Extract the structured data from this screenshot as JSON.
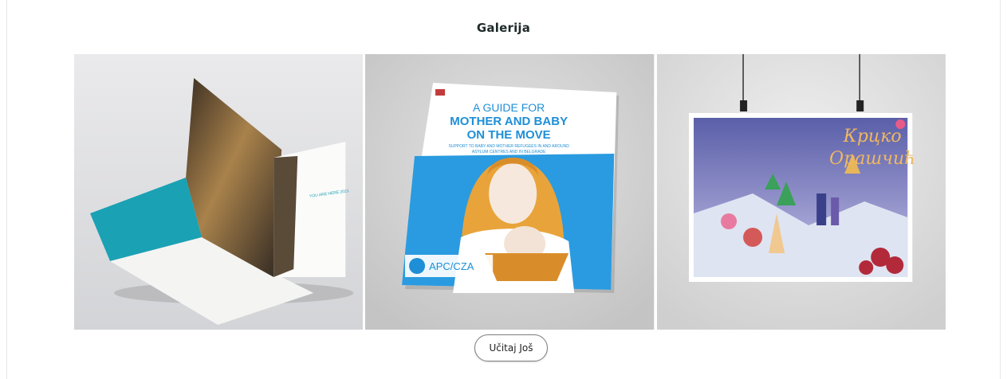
{
  "section": {
    "title": "Galerija",
    "load_more_label": "Učitaj Još"
  },
  "gallery": {
    "items": [
      {
        "icon": "brochure-image",
        "caption_lines": [
          "YOU ARE HERE 2021"
        ]
      },
      {
        "icon": "guide-cover-image",
        "header": "A GUIDE FOR",
        "title_lines": [
          "MOTHER AND BABY",
          "ON THE MOVE"
        ],
        "subtitle_lines": [
          "SUPPORT TO BABY AND MOTHER REFUGEES IN AND AROUND",
          "ASYLUM CENTRES AND IN BELGRADE"
        ],
        "logo_text": "APC/CZA"
      },
      {
        "icon": "poster-image",
        "title_lines": [
          "Крцко",
          "Орашчић"
        ]
      }
    ]
  },
  "colors": {
    "accent_blue": "#1e8fd6",
    "guide_blue": "#2a9be0",
    "text_dark": "#1f2a2a"
  }
}
